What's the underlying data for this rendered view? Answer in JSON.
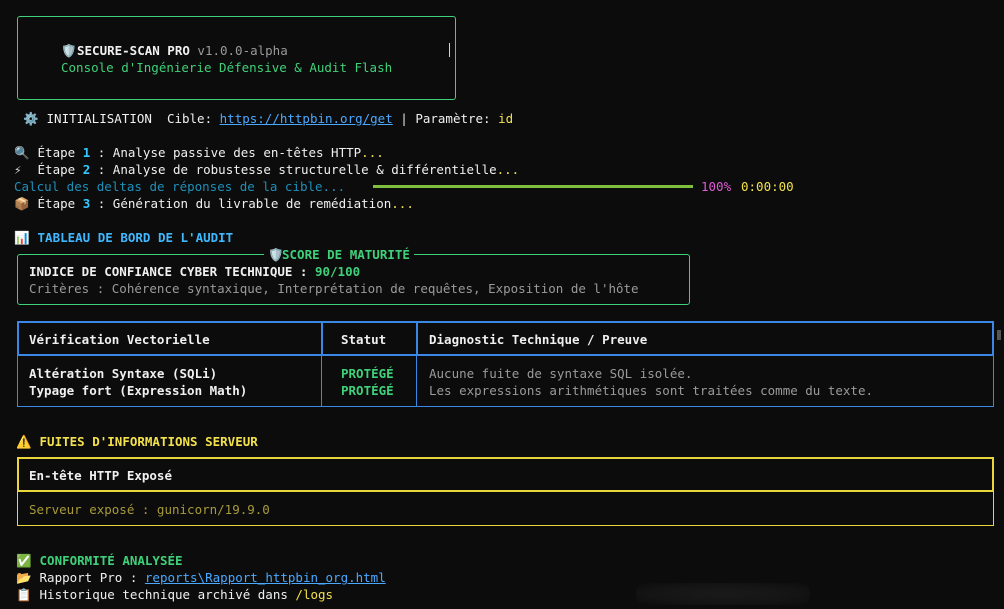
{
  "header": {
    "app_name": "SECURE-SCAN PRO",
    "version": "v1.0.0-alpha",
    "subtitle": "Console d'Ingénierie Défensive & Audit Flash",
    "shield_icon": "🛡️"
  },
  "init": {
    "icon": "⚙️",
    "label": "INITIALISATION",
    "target_label": "Cible:",
    "target_url": "https://httpbin.org/get",
    "separator": "|",
    "param_label": "Paramètre:",
    "param_value": "id"
  },
  "steps": [
    {
      "icon": "🔍",
      "prefix": "Étape",
      "number": "1",
      "text": " : Analyse passive des en-têtes HTTP",
      "dots": "..."
    },
    {
      "icon": "⚡",
      "prefix": "Étape",
      "number": "2",
      "text": " : Analyse de robustesse structurelle & différentielle",
      "dots": "..."
    },
    {
      "icon": "📦",
      "prefix": "Étape",
      "number": "3",
      "text": " : Génération du livrable de remédiation",
      "dots": "..."
    }
  ],
  "progress": {
    "label": "Calcul des deltas de réponses de la cible...",
    "percent_text": "100%",
    "percent": 100,
    "elapsed": "0:00:00"
  },
  "dashboard": {
    "icon": "📊",
    "title": "TABLEAU DE BORD DE L'AUDIT"
  },
  "score": {
    "icon": "🛡️",
    "title": "SCORE DE MATURITÉ",
    "index_label": "INDICE DE CONFIANCE CYBER TECHNIQUE :",
    "index_value": "90/100",
    "criteria": "Critères : Cohérence syntaxique, Interprétation de requêtes, Exposition de l'hôte"
  },
  "vector_table": {
    "headers": [
      "Vérification Vectorielle",
      "Statut",
      "Diagnostic Technique / Preuve"
    ],
    "rows": [
      {
        "check": "Altération Syntaxe (SQLi)",
        "status": "PROTÉGÉ",
        "diagnostic": "Aucune fuite de syntaxe SQL isolée."
      },
      {
        "check": "Typage fort (Expression Math)",
        "status": "PROTÉGÉ",
        "diagnostic": "Les expressions arithmétiques sont traitées comme du texte."
      }
    ]
  },
  "leaks": {
    "icon": "⚠️",
    "title": "FUITES D'INFORMATIONS SERVEUR",
    "header": "En-tête HTTP Exposé",
    "row": "Serveur exposé : gunicorn/19.9.0"
  },
  "conformity": {
    "icon": "✅",
    "title": "CONFORMITÉ ANALYSÉE",
    "report_icon": "📂",
    "report_label": "Rapport Pro :",
    "report_path": "reports\\Rapport_httpbin_org.html",
    "history_icon": "📋",
    "history_label": "Historique technique archivé dans",
    "history_path": "/logs"
  },
  "colors": {
    "green": "#3fd17a",
    "blue_border": "#3a87e6",
    "yellow_border": "#e8d63a",
    "link": "#4aa8ff"
  }
}
